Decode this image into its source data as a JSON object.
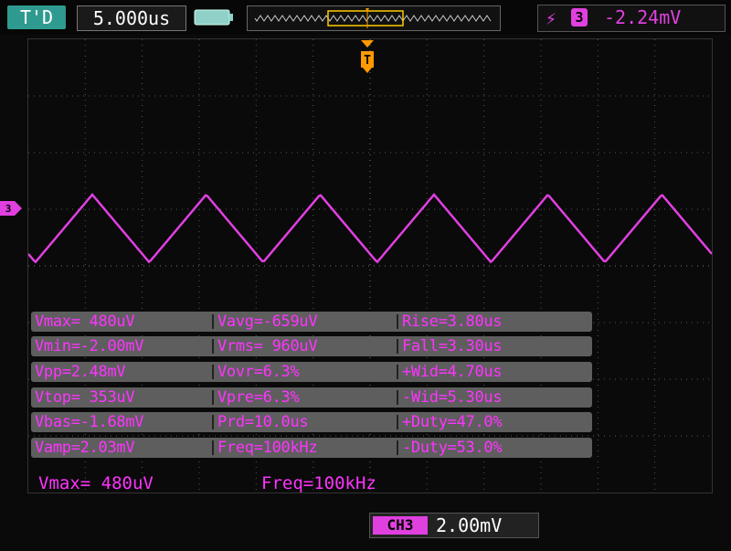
{
  "header": {
    "run_state": "T'D",
    "timebase": "5.000us",
    "trigger_edge_icon": "rising-edge-icon",
    "trigger_channel": "3",
    "trigger_level": "-2.24mV"
  },
  "colors": {
    "trace": "#e040e0",
    "measurement_text": "#ff33ff",
    "trigger_marker": "#ff9900",
    "run_state_bg": "#2f9a8f"
  },
  "trigger_marker_label": "T",
  "channel_marker_label": "3",
  "measurements": [
    {
      "col1": "Vmax= 480uV",
      "col2": "Vavg=-659uV",
      "col3": "Rise=3.80us"
    },
    {
      "col1": "Vmin=-2.00mV",
      "col2": "Vrms= 960uV",
      "col3": "Fall=3.30us"
    },
    {
      "col1": "Vpp=2.48mV",
      "col2": "Vovr=6.3%",
      "col3": "+Wid=4.70us"
    },
    {
      "col1": "Vtop= 353uV",
      "col2": "Vpre=6.3%",
      "col3": "-Wid=5.30us"
    },
    {
      "col1": "Vbas=-1.68mV",
      "col2": "Prd=10.0us",
      "col3": "+Duty=47.0%"
    },
    {
      "col1": "Vamp=2.03mV",
      "col2": "Freq=100kHz",
      "col3": "-Duty=53.0%"
    }
  ],
  "bottom_readout": {
    "vmax": "Vmax= 480uV",
    "freq": "Freq=100kHz"
  },
  "channel_badge": {
    "name": "CH3",
    "scale": "2.00mV"
  }
}
